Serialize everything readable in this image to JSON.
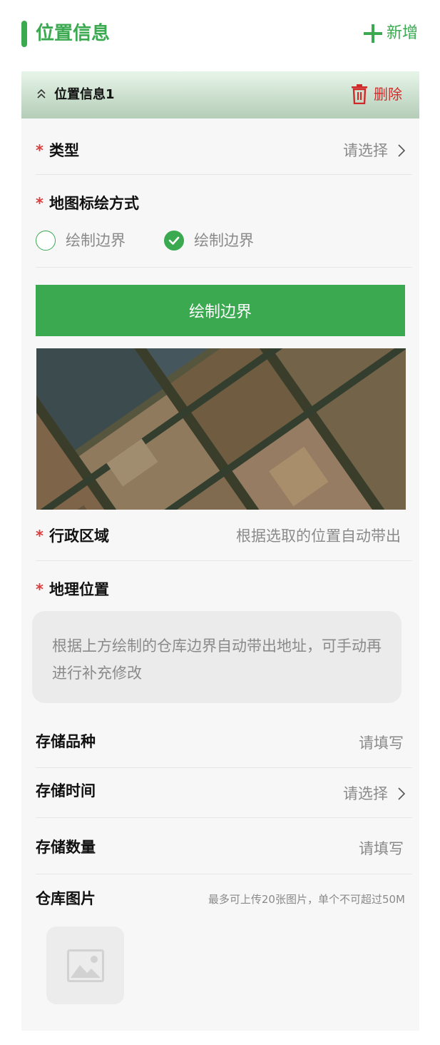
{
  "header": {
    "title": "位置信息",
    "add_label": "新增"
  },
  "card": {
    "title": "位置信息1",
    "delete_label": "删除"
  },
  "form": {
    "type": {
      "label": "类型",
      "placeholder": "请选择"
    },
    "draw_method": {
      "label": "地图标绘方式",
      "options": [
        {
          "label": "绘制边界",
          "selected": false
        },
        {
          "label": "绘制边界",
          "selected": true
        }
      ]
    },
    "draw_button": "绘制边界",
    "region": {
      "label": "行政区域",
      "value": "根据选取的位置自动带出"
    },
    "geo": {
      "label": "地理位置",
      "placeholder": "根据上方绘制的仓库边界自动带出地址，可手动再进行补充修改"
    },
    "variety": {
      "label": "存储品种",
      "placeholder": "请填写"
    },
    "time": {
      "label": "存储时间",
      "placeholder": "请选择"
    },
    "quantity": {
      "label": "存储数量",
      "placeholder": "请填写"
    },
    "photos": {
      "label": "仓库图片",
      "tip": "最多可上传20张图片，单个不可超过50M"
    }
  },
  "icons": {
    "add": "plus-icon",
    "collapse": "chevron-up-icon",
    "delete": "trash-icon",
    "arrow": "chevron-right-icon",
    "check": "check-icon",
    "image": "image-placeholder-icon"
  },
  "colors": {
    "brand": "#3aa950",
    "danger": "#d12a2a",
    "required": "#e03a3a"
  }
}
